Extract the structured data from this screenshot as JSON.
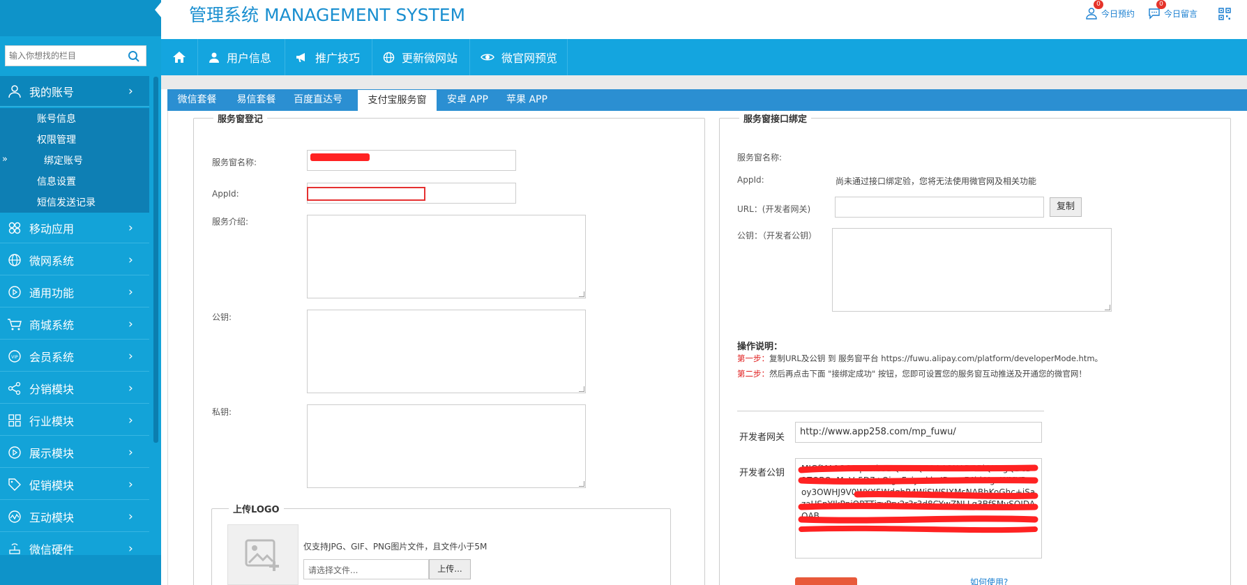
{
  "app": {
    "title": "管理系统 MANAGEMENT SYSTEM"
  },
  "header": {
    "links": [
      {
        "label": "今日预约",
        "badge": "0",
        "icon": "user-icon"
      },
      {
        "label": "今日留言",
        "badge": "0",
        "icon": "message-icon"
      }
    ],
    "qr_icon": "qrcode-icon"
  },
  "sidebar": {
    "search_placeholder": "输入你想找的栏目",
    "items": [
      {
        "label": "我的账号",
        "icon": "user-icon"
      },
      {
        "label": "移动应用",
        "icon": "apps-icon"
      },
      {
        "label": "微网系统",
        "icon": "globe-icon"
      },
      {
        "label": "通用功能",
        "icon": "play-icon"
      },
      {
        "label": "商城系统",
        "icon": "cart-icon"
      },
      {
        "label": "会员系统",
        "icon": "vip-icon"
      },
      {
        "label": "分销模块",
        "icon": "share-icon"
      },
      {
        "label": "行业模块",
        "icon": "grid-icon"
      },
      {
        "label": "展示模块",
        "icon": "play-icon"
      },
      {
        "label": "促销模块",
        "icon": "tag-icon"
      },
      {
        "label": "互动模块",
        "icon": "pulse-icon"
      },
      {
        "label": "微信硬件",
        "icon": "router-icon"
      }
    ],
    "submenu": [
      "账号信息",
      "权限管理",
      "绑定账号",
      "信息设置",
      "短信发送记录"
    ],
    "chevron": "›"
  },
  "topnav": {
    "items": [
      {
        "label": "",
        "icon": "home-icon"
      },
      {
        "label": "用户信息",
        "icon": "user-icon"
      },
      {
        "label": "推广技巧",
        "icon": "megaphone-icon"
      },
      {
        "label": "更新微网站",
        "icon": "globe-icon"
      },
      {
        "label": "微官网预览",
        "icon": "eye-icon"
      }
    ]
  },
  "tabs": [
    "微信套餐",
    "易信套餐",
    "百度直达号",
    "支付宝服务窗",
    "安卓 APP",
    "苹果 APP"
  ],
  "left_form": {
    "legend": "服务窗登记",
    "name_label": "服务窗名称:",
    "appid_label": "AppId:",
    "intro_label": "服务介绍:",
    "pubkey_label": "公钥:",
    "privkey_label": "私钥:",
    "logo_legend": "上传LOGO",
    "logo_note": "仅支持JPG、GIF、PNG图片文件，且文件小于5M",
    "file_placeholder": "请选择文件...",
    "upload_button": "上传..."
  },
  "right_form": {
    "legend": "服务窗接口绑定",
    "name_label": "服务窗名称:",
    "appid_label": "AppId:",
    "appid_value": "尚未通过接口绑定验，您将无法使用微官网及相关功能",
    "url_label": "URL：(开发者网关)",
    "copy_button": "复制",
    "pubkey_label": "公钥：（开发者公钥）",
    "instructions_title": "操作说明：",
    "step1_prefix": "第一步：",
    "step1_text": "复制URL及公钥 到 服务窗平台 https://fuwu.alipay.com/platform/developerMode.htm。",
    "step2_prefix": "第二步：",
    "step2_text": "然后再点击下面 \"接绑定成功\" 按钮，您即可设置您的服务窗互动推送及开通您的微官网！",
    "gateway_label": "开发者网关",
    "gateway_value": "http://www.app258.com/mp_fuwu/",
    "devkey_label": "开发者公钥",
    "devkey_value": "MIGfMA0GCSqGSIb3DQEBAQUAA4GNADCBiQKBgQDcD2ZOBOuMaVr5D7+QiguFoiy+kkvIDuecF4hkYgeWMYBeoy3OWHJ9V0WYX5WdqhB4WjSWSIXMsNABhKoGhc+iSazaUSpYJkPpjQPTTjzyPrv2r3r3d8CYwZNLLg3BfSMvSQIDAQAB",
    "help_link": "如何使用?"
  },
  "colors": {
    "sidebar": "#13a3d8",
    "topnav": "#14a5df",
    "tabbar": "#2b8fd2",
    "logo": "#1a8fd0",
    "step": "#e02020",
    "redaction": "#ff2222"
  }
}
